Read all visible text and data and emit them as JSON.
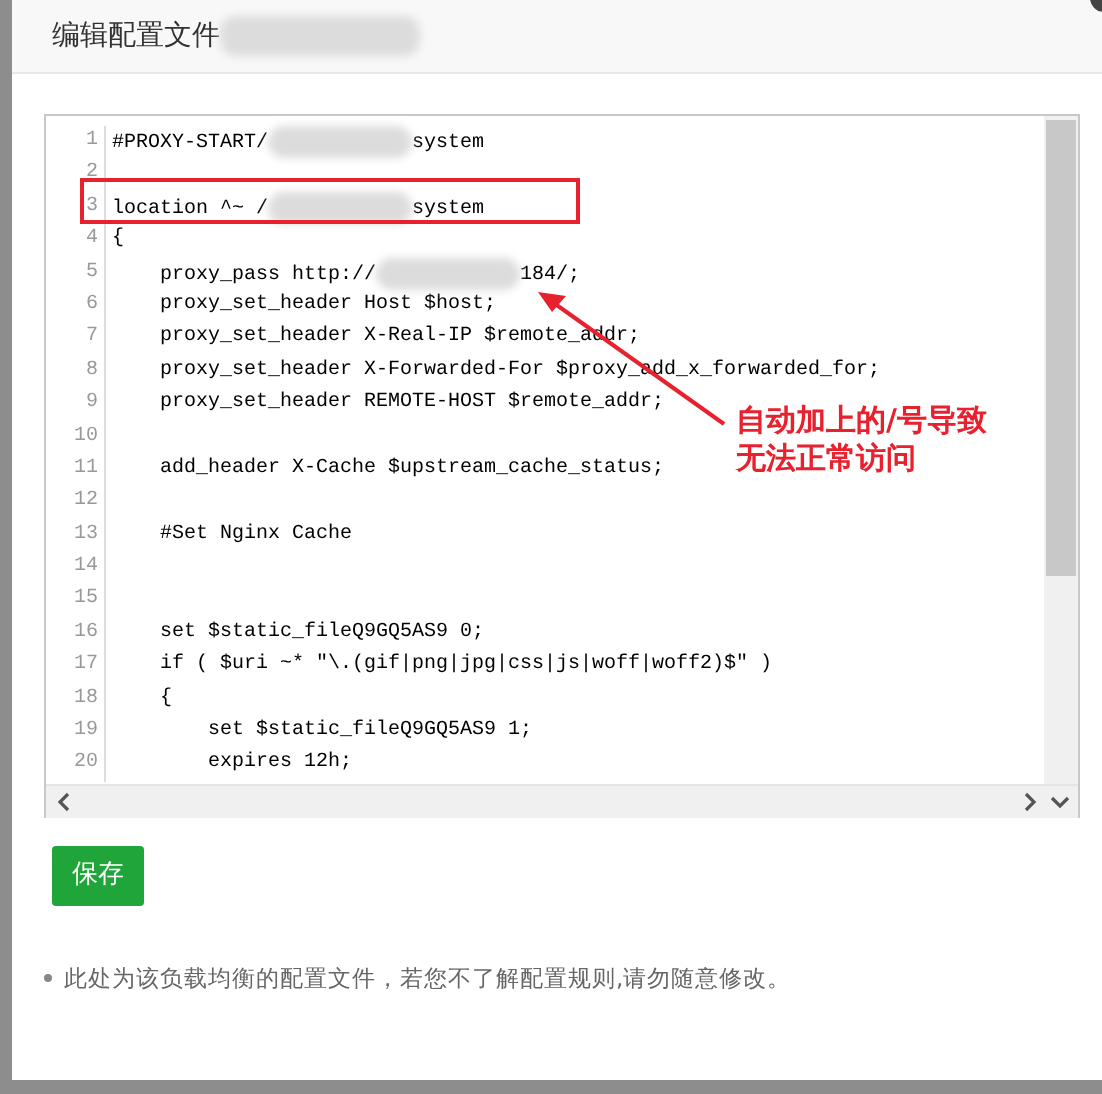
{
  "dialog": {
    "title": [
      {
        "kind": "text",
        "text": "编辑配置文件"
      },
      {
        "kind": "redacted"
      }
    ]
  },
  "editor": {
    "lines": [
      {
        "number": "1",
        "parts": [
          {
            "kind": "text",
            "text": "#PROXY-START/"
          },
          {
            "kind": "redacted"
          },
          {
            "kind": "text",
            "text": "system"
          }
        ]
      },
      {
        "number": "2"
      },
      {
        "number": "3",
        "parts": [
          {
            "kind": "text",
            "text": "location ^~ /"
          },
          {
            "kind": "redacted"
          },
          {
            "kind": "text",
            "text": "system"
          }
        ]
      },
      {
        "number": "4",
        "parts": [
          {
            "kind": "text",
            "text": "{"
          }
        ]
      },
      {
        "number": "5",
        "parts": [
          {
            "kind": "text",
            "text": "    proxy_pass http://"
          },
          {
            "kind": "redacted"
          },
          {
            "kind": "text",
            "text": "184/;"
          }
        ]
      },
      {
        "number": "6",
        "parts": [
          {
            "kind": "text",
            "text": "    proxy_set_header Host $host;"
          }
        ]
      },
      {
        "number": "7",
        "parts": [
          {
            "kind": "text",
            "text": "    proxy_set_header X-Real-IP $remote_addr;"
          }
        ]
      },
      {
        "number": "8",
        "parts": [
          {
            "kind": "text",
            "text": "    proxy_set_header X-Forwarded-For $proxy_add_x_forwarded_for;"
          }
        ]
      },
      {
        "number": "9",
        "parts": [
          {
            "kind": "text",
            "text": "    proxy_set_header REMOTE-HOST $remote_addr;"
          }
        ]
      },
      {
        "number": "10"
      },
      {
        "number": "11",
        "parts": [
          {
            "kind": "text",
            "text": "    add_header X-Cache $upstream_cache_status;"
          }
        ]
      },
      {
        "number": "12"
      },
      {
        "number": "13",
        "parts": [
          {
            "kind": "text",
            "text": "    #Set Nginx Cache"
          }
        ]
      },
      {
        "number": "14"
      },
      {
        "number": "15"
      },
      {
        "number": "16",
        "parts": [
          {
            "kind": "text",
            "text": "    set $static_fileQ9GQ5AS9 0;"
          }
        ]
      },
      {
        "number": "17",
        "parts": [
          {
            "kind": "text",
            "text": "    if ( $uri ~* \"\\.(gif|png|jpg|css|js|woff|woff2)$\" )"
          }
        ]
      },
      {
        "number": "18",
        "parts": [
          {
            "kind": "text",
            "text": "    {"
          }
        ]
      },
      {
        "number": "19",
        "parts": [
          {
            "kind": "text",
            "text": "        set $static_fileQ9GQ5AS9 1;"
          }
        ]
      },
      {
        "number": "20",
        "parts": [
          {
            "kind": "text",
            "text": "        expires 12h;"
          }
        ]
      }
    ]
  },
  "annotation": {
    "text": "自动加上的/号导致无法正常访问"
  },
  "save_button": "保存",
  "notes": [
    "此处为该负载均衡的配置文件，若您不了解配置规则,请勿随意修改。"
  ]
}
